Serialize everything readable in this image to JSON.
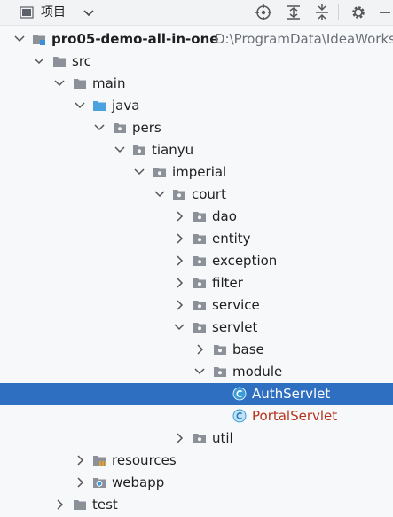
{
  "header": {
    "title": "项目",
    "icons": [
      "project-view-icon",
      "dropdown-caret-icon",
      "target-icon",
      "expand-all-icon",
      "collapse-all-icon",
      "gear-icon",
      "minimize-icon"
    ]
  },
  "tree": {
    "root": {
      "label": "pro05-demo-all-in-one",
      "path": "D:\\ProgramData\\IdeaWorks"
    },
    "src": "src",
    "main": "main",
    "java": "java",
    "pers": "pers",
    "tianyu": "tianyu",
    "imperial": "imperial",
    "court": "court",
    "dao": "dao",
    "entity": "entity",
    "exception": "exception",
    "filter": "filter",
    "service": "service",
    "servlet": "servlet",
    "base": "base",
    "module": "module",
    "auth_servlet": "AuthServlet",
    "portal_servlet": "PortalServlet",
    "util": "util",
    "resources": "resources",
    "webapp": "webapp",
    "test": "test"
  },
  "colors": {
    "selection": "#2f6fc1",
    "folder": "#8c9099",
    "source_folder": "#4aa3df",
    "class_icon": "#3a9bd9",
    "modified_file": "#b5331b"
  }
}
